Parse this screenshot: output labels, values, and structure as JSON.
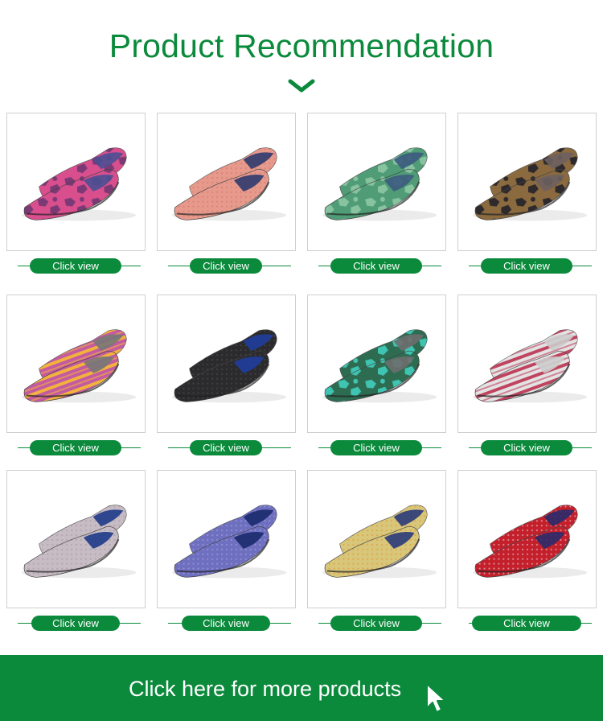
{
  "header": {
    "title": "Product Recommendation",
    "chevron_icon": "chevron-down-icon"
  },
  "products": [
    {
      "label": "Click view",
      "colors": {
        "main": "#d94f8e",
        "accent": "#7b3a75",
        "pattern": "camo",
        "insole": "#4a4f92"
      }
    },
    {
      "label": "Click view",
      "colors": {
        "main": "#e79a8c",
        "accent": "#d07a6c",
        "pattern": "knit",
        "insole": "#2f3a6e"
      }
    },
    {
      "label": "Click view",
      "colors": {
        "main": "#4f9c76",
        "accent": "#87c39f",
        "pattern": "camo",
        "insole": "#3c5b80"
      }
    },
    {
      "label": "Click view",
      "colors": {
        "main": "#8a6a3e",
        "accent": "#2e2a2c",
        "pattern": "camo",
        "insole": "#6d6060"
      }
    },
    {
      "label": "Click view",
      "colors": {
        "main": "#c45aa0",
        "accent": "#f2b33d",
        "pattern": "stripes",
        "insole": "#777777"
      }
    },
    {
      "label": "Click view",
      "colors": {
        "main": "#2b2b2d",
        "accent": "#4a4a4e",
        "pattern": "knit",
        "insole": "#1f3d9c"
      }
    },
    {
      "label": "Click view",
      "colors": {
        "main": "#2e6c52",
        "accent": "#3fc4b2",
        "pattern": "camo",
        "insole": "#6e6e6e"
      }
    },
    {
      "label": "Click view",
      "colors": {
        "main": "#e3e3e3",
        "accent": "#c0435f",
        "pattern": "stripes",
        "insole": "#cccccc"
      }
    },
    {
      "label": "Click view",
      "colors": {
        "main": "#c8bcc4",
        "accent": "#a89ca6",
        "pattern": "knit",
        "insole": "#1e3a8a"
      }
    },
    {
      "label": "Click view",
      "colors": {
        "main": "#6f6fc0",
        "accent": "#9b9be0",
        "pattern": "knit",
        "insole": "#1a2a6a"
      }
    },
    {
      "label": "Click view",
      "colors": {
        "main": "#d8c67a",
        "accent": "#e39b3a",
        "pattern": "knit",
        "insole": "#2a3a7a"
      }
    },
    {
      "label": "Click view",
      "colors": {
        "main": "#c4202b",
        "accent": "#e8b3c0",
        "pattern": "knit",
        "insole": "#2a2a6a"
      }
    }
  ],
  "footer": {
    "text": "Click here for more products",
    "cursor_icon": "mouse-pointer-icon"
  },
  "theme": {
    "brand_green": "#0b8a3c",
    "card_border": "#cfcfcf"
  }
}
